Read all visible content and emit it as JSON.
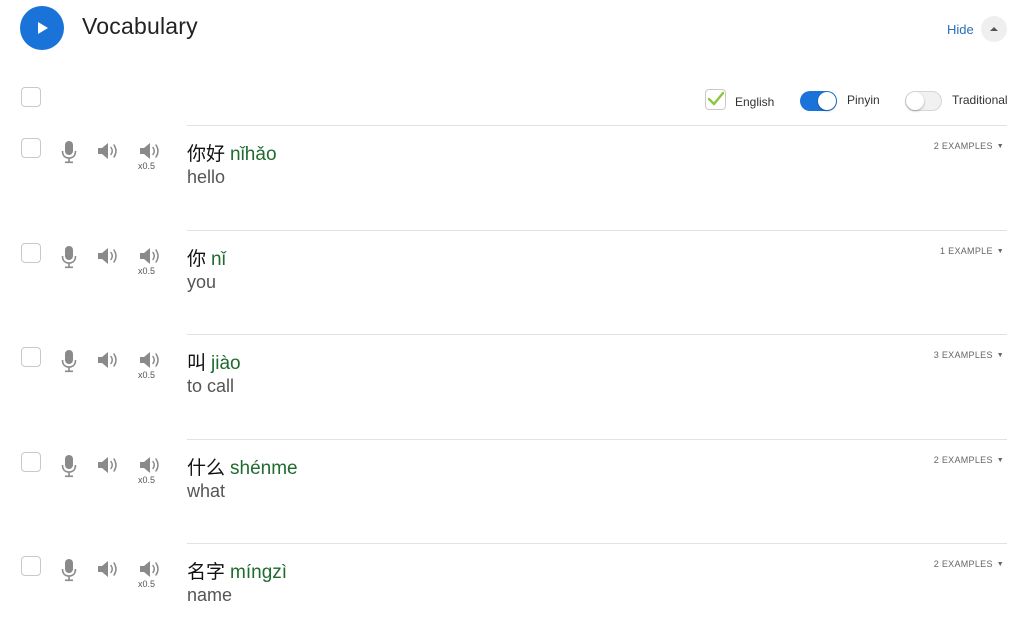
{
  "header": {
    "title": "Vocabulary",
    "hide_label": "Hide"
  },
  "options": {
    "english_label": "English",
    "english_checked": true,
    "pinyin_label": "Pinyin",
    "pinyin_on": true,
    "traditional_label": "Traditional",
    "traditional_on": false
  },
  "words": [
    {
      "hanzi": "你好",
      "pinyin": "nǐhǎo",
      "meaning": "hello",
      "examples": "2 EXAMPLES",
      "slow_label": "x0.5"
    },
    {
      "hanzi": "你",
      "pinyin": "nǐ",
      "meaning": "you",
      "examples": "1 EXAMPLE",
      "slow_label": "x0.5"
    },
    {
      "hanzi": "叫",
      "pinyin": "jiào",
      "meaning": "to call",
      "examples": "3 EXAMPLES",
      "slow_label": "x0.5"
    },
    {
      "hanzi": "什么",
      "pinyin": "shénme",
      "meaning": "what",
      "examples": "2 EXAMPLES",
      "slow_label": "x0.5"
    },
    {
      "hanzi": "名字",
      "pinyin": "míngzì",
      "meaning": "name",
      "examples": "2 EXAMPLES",
      "slow_label": "x0.5"
    }
  ],
  "colors": {
    "accent": "#1a73d9",
    "pinyin": "#1f6b2f",
    "check": "#8cc63f",
    "link": "#2a6fb8"
  },
  "icons": {
    "play": "play-icon",
    "collapse": "chevron-up-icon",
    "mic": "microphone-icon",
    "speaker": "speaker-icon",
    "speaker_slow": "speaker-slow-icon",
    "check": "checkmark-icon",
    "caret": "caret-down-icon"
  }
}
